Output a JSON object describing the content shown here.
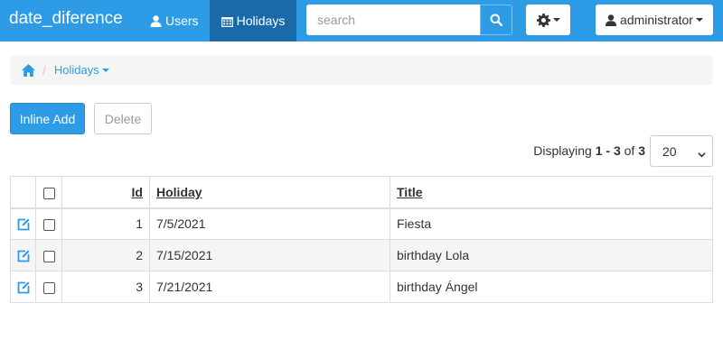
{
  "app": {
    "brand": "date_diference"
  },
  "nav": {
    "users_label": "Users",
    "holidays_label": "Holidays"
  },
  "search": {
    "placeholder": "search",
    "value": ""
  },
  "user_menu": {
    "label": "administrator"
  },
  "breadcrumb": {
    "current": "Holidays"
  },
  "toolbar": {
    "inline_add_label": "Inline Add",
    "delete_label": "Delete"
  },
  "paging": {
    "prefix": "Displaying",
    "range": "1 - 3",
    "of_word": "of",
    "total": "3",
    "page_size": "20",
    "page_size_options": [
      "20"
    ]
  },
  "table": {
    "columns": {
      "id": "Id",
      "holiday": "Holiday",
      "title": "Title"
    },
    "rows": [
      {
        "id": "1",
        "holiday": "7/5/2021",
        "title": "Fiesta"
      },
      {
        "id": "2",
        "holiday": "7/15/2021",
        "title": "birthday Lola"
      },
      {
        "id": "3",
        "holiday": "7/21/2021",
        "title": "birthday Ángel"
      }
    ]
  },
  "icons": {
    "user": "user-icon",
    "calendar": "calendar-icon",
    "search": "search-icon",
    "gear": "gear-icon",
    "home": "home-icon",
    "edit": "edit-icon",
    "caret": "caret-down-icon"
  },
  "colors": {
    "navbar": "#2d9be6",
    "nav_active": "#1a6aa9",
    "accent": "#2d9be6",
    "breadcrumb_bg": "#f5f5f5",
    "row_stripe": "#f5f5f5"
  }
}
